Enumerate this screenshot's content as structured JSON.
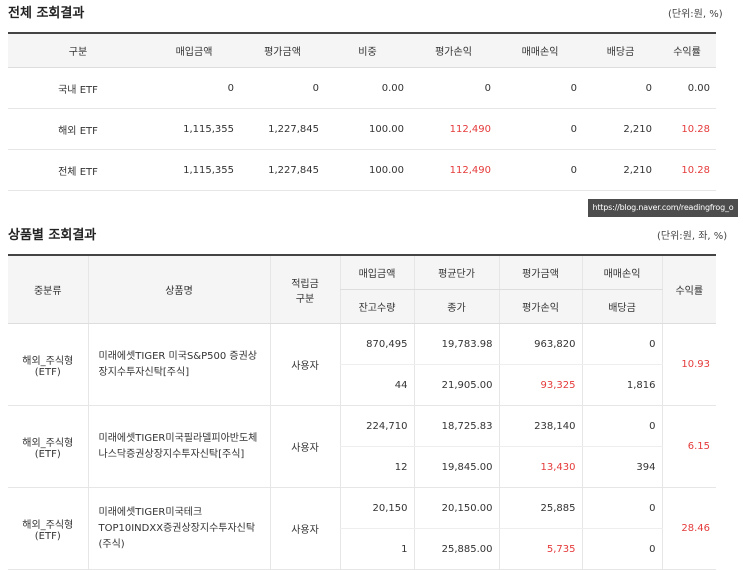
{
  "summary": {
    "title": "전체 조회결과",
    "unit": "(단위:원, %)",
    "headers": [
      "구분",
      "매입금액",
      "평가금액",
      "비중",
      "평가손익",
      "매매손익",
      "배당금",
      "수익률"
    ],
    "rows": [
      {
        "label": "국내 ETF",
        "buy": "0",
        "eval": "0",
        "weight": "0.00",
        "eval_pl": "0",
        "trade_pl": "0",
        "dividend": "0",
        "return": "0.00"
      },
      {
        "label": "해외 ETF",
        "buy": "1,115,355",
        "eval": "1,227,845",
        "weight": "100.00",
        "eval_pl": "112,490",
        "trade_pl": "0",
        "dividend": "2,210",
        "return": "10.28"
      },
      {
        "label": "전체 ETF",
        "buy": "1,115,355",
        "eval": "1,227,845",
        "weight": "100.00",
        "eval_pl": "112,490",
        "trade_pl": "0",
        "dividend": "2,210",
        "return": "10.28"
      }
    ]
  },
  "watermark": "https://blog.naver.com/readingfrog_o",
  "detail": {
    "title": "상품별 조회결과",
    "unit": "(단위:원, 좌, %)",
    "headers": {
      "category": "중분류",
      "product": "상품명",
      "accum_type": "적립금 구분",
      "buy_amount": "매입금액",
      "avg_price": "평균단가",
      "eval_amount": "평가금액",
      "trade_pl": "매매손익",
      "return": "수익률",
      "balance_qty": "잔고수량",
      "close_price": "종가",
      "eval_pl": "평가손익",
      "dividend": "배당금"
    },
    "rows": [
      {
        "category": "해외_주식형(ETF)",
        "product": "미래에셋TIGER 미국S&P500 증권상장지수투자신탁[주식]",
        "accum_type": "사용자",
        "buy_amount": "870,495",
        "avg_price": "19,783.98",
        "eval_amount": "963,820",
        "trade_pl": "0",
        "balance_qty": "44",
        "close_price": "21,905.00",
        "eval_pl": "93,325",
        "dividend": "1,816",
        "return": "10.93"
      },
      {
        "category": "해외_주식형(ETF)",
        "product": "미래에셋TIGER미국필라델피아반도체나스닥증권상장지수투자신탁[주식]",
        "accum_type": "사용자",
        "buy_amount": "224,710",
        "avg_price": "18,725.83",
        "eval_amount": "238,140",
        "trade_pl": "0",
        "balance_qty": "12",
        "close_price": "19,845.00",
        "eval_pl": "13,430",
        "dividend": "394",
        "return": "6.15"
      },
      {
        "category": "해외_주식형(ETF)",
        "product": "미래에셋TIGER미국테크TOP10INDXX증권상장지수투자신탁(주식)",
        "accum_type": "사용자",
        "buy_amount": "20,150",
        "avg_price": "20,150.00",
        "eval_amount": "25,885",
        "trade_pl": "0",
        "balance_qty": "1",
        "close_price": "25,885.00",
        "eval_pl": "5,735",
        "dividend": "0",
        "return": "28.46"
      }
    ]
  }
}
